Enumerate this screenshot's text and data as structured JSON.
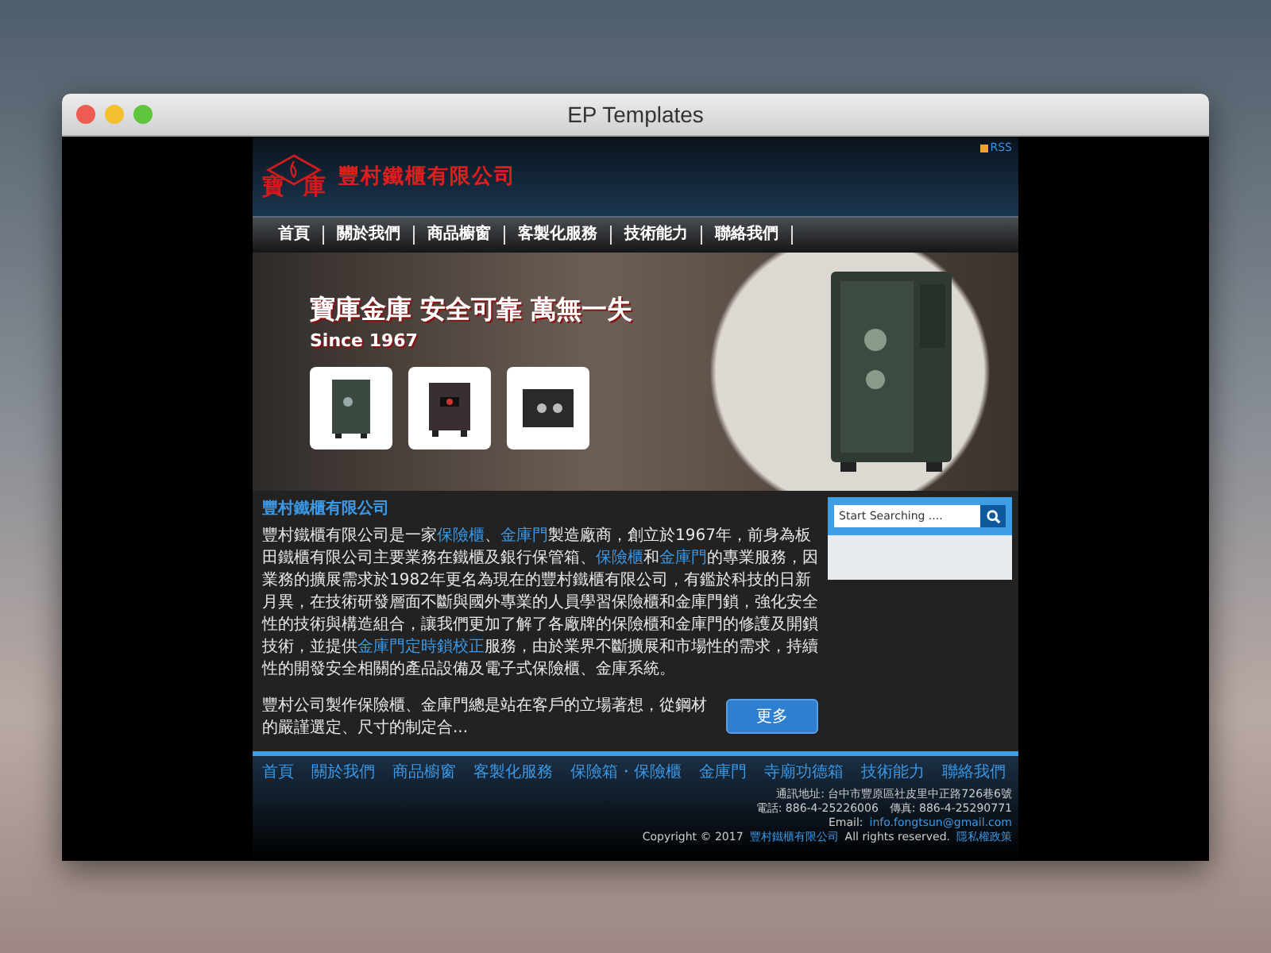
{
  "window": {
    "title": "EP Templates"
  },
  "header": {
    "rss": "RSS",
    "logo_chars": [
      "寶",
      "庫"
    ],
    "company": "豐村鐵櫃有限公司"
  },
  "nav": [
    "首頁",
    "關於我們",
    "商品櫥窗",
    "客製化服務",
    "技術能力",
    "聯絡我們"
  ],
  "banner": {
    "headline": "寶庫金庫 安全可靠 萬無一失",
    "since": "Since 1967"
  },
  "main": {
    "heading": "豐村鐵櫃有限公司",
    "paragraph": [
      {
        "kind": "text",
        "text": "豐村鐵櫃有限公司是一家"
      },
      {
        "kind": "link",
        "text": "保險櫃"
      },
      {
        "kind": "text",
        "text": "、"
      },
      {
        "kind": "link",
        "text": "金庫門"
      },
      {
        "kind": "text",
        "text": "製造廠商，創立於1967年，前身為板田鐵櫃有限公司主要業務在鐵櫃及銀行保管箱、"
      },
      {
        "kind": "link",
        "text": "保險櫃"
      },
      {
        "kind": "text",
        "text": "和"
      },
      {
        "kind": "link",
        "text": "金庫門"
      },
      {
        "kind": "text",
        "text": "的專業服務，因業務的擴展需求於1982年更名為現在的豐村鐵櫃有限公司，有鑑於科技的日新月異，在技術研發層面不斷與國外專業的人員學習保險櫃和金庫門鎖，強化安全性的技術與構造組合，讓我們更加了解了各廠牌的保險櫃和金庫門的修護及開鎖技術，並提供"
      },
      {
        "kind": "link",
        "text": "金庫門定時鎖校正"
      },
      {
        "kind": "text",
        "text": "服務，由於業界不斷擴展和市場性的需求，持續性的開發安全相關的產品設備及電子式保險櫃、金庫系統。"
      }
    ],
    "excerpt": "豐村公司製作保險櫃、金庫門總是站在客戶的立場著想，從鋼材的嚴謹選定、尺寸的制定合...",
    "more": "更多"
  },
  "search": {
    "placeholder": "Start Searching ...."
  },
  "footer": {
    "nav": [
      "首頁",
      "關於我們",
      "商品櫥窗",
      "客製化服務",
      "保險箱・保險櫃",
      "金庫門",
      "寺廟功德箱",
      "技術能力",
      "聯絡我們"
    ],
    "address": "通訊地址: 台中市豐原區社皮里中正路726巷6號",
    "phone": "電話: 886-4-25226006　傳真: 886-4-25290771",
    "email_label": "Email:",
    "email": "info.fongtsun@gmail.com",
    "copyright": "Copyright © 2017",
    "copyright_company": "豐村鐵櫃有限公司",
    "rights": "All rights reserved.",
    "privacy": "隱私權政策"
  }
}
